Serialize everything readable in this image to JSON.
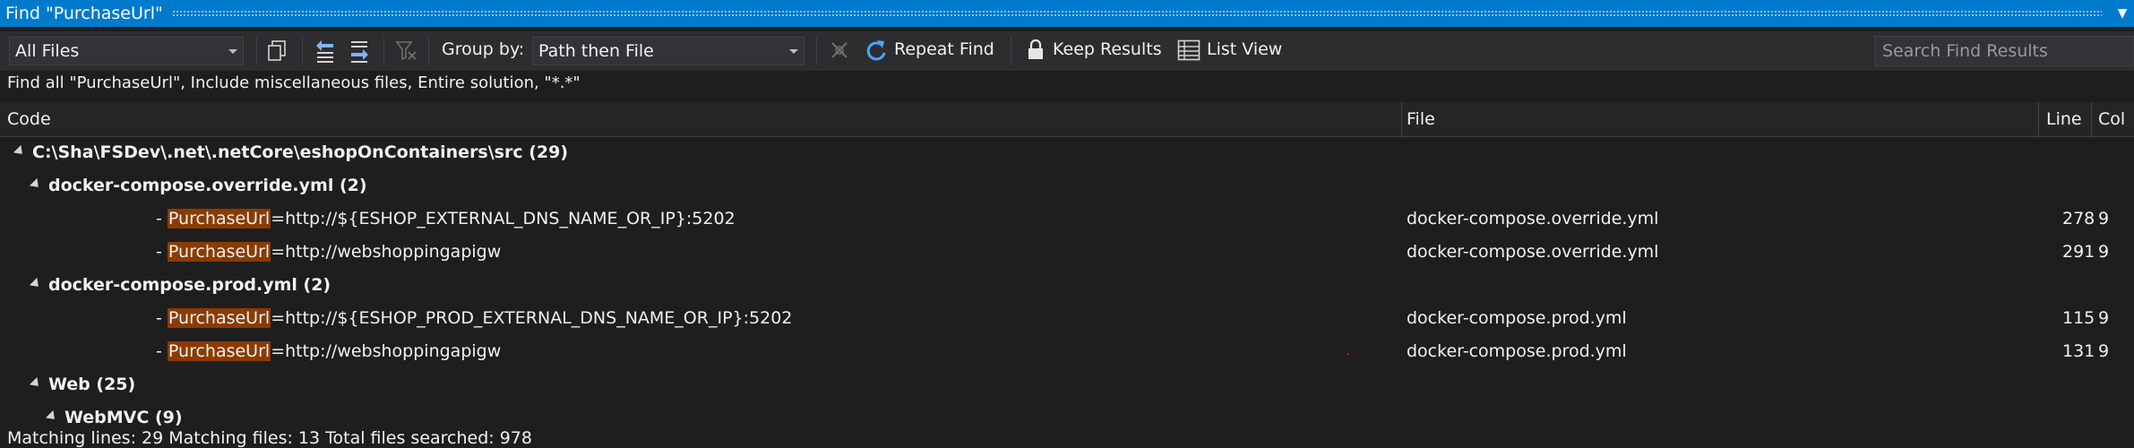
{
  "window": {
    "title": "Find \"PurchaseUrl\""
  },
  "toolbar": {
    "scope_value": "All Files",
    "group_by_label": "Group by:",
    "group_by_value": "Path then File",
    "repeat_find_label": "Repeat Find",
    "keep_results_label": "Keep Results",
    "list_view_label": "List View",
    "search_placeholder": "Search Find Results"
  },
  "description": "Find all \"PurchaseUrl\", Include miscellaneous files, Entire solution, \"*.*\"",
  "columns": {
    "code": "Code",
    "file": "File",
    "line": "Line",
    "col": "Col"
  },
  "tree": {
    "root": {
      "path": "C:\\Sha\\FSDev\\.net\\.netCore\\eshopOnContainers\\src",
      "count": "(29)"
    },
    "groups": [
      {
        "name": "docker-compose.override.yml",
        "count": "(2)",
        "results": [
          {
            "prefix": "- ",
            "match": "PurchaseUrl",
            "rest": "=http://${ESHOP_EXTERNAL_DNS_NAME_OR_IP}:5202",
            "file": "docker-compose.override.yml",
            "line": "278",
            "col": "9"
          },
          {
            "prefix": "- ",
            "match": "PurchaseUrl",
            "rest": "=http://webshoppingapigw",
            "file": "docker-compose.override.yml",
            "line": "291",
            "col": "9"
          }
        ]
      },
      {
        "name": "docker-compose.prod.yml",
        "count": "(2)",
        "results": [
          {
            "prefix": "- ",
            "match": "PurchaseUrl",
            "rest": "=http://${ESHOP_PROD_EXTERNAL_DNS_NAME_OR_IP}:5202",
            "file": "docker-compose.prod.yml",
            "line": "115",
            "col": "9"
          },
          {
            "prefix": "- ",
            "match": "PurchaseUrl",
            "rest": "=http://webshoppingapigw",
            "file": "docker-compose.prod.yml",
            "line": "131",
            "col": "9"
          }
        ]
      },
      {
        "name": "Web",
        "count": "(25)"
      },
      {
        "name": "WebMVC",
        "count": "(9)"
      }
    ]
  },
  "status": "Matching lines: 29 Matching files: 13 Total files searched: 978",
  "colors": {
    "accent": "#007acc",
    "highlight": "#8a3b00",
    "background": "#1e1e1e"
  }
}
